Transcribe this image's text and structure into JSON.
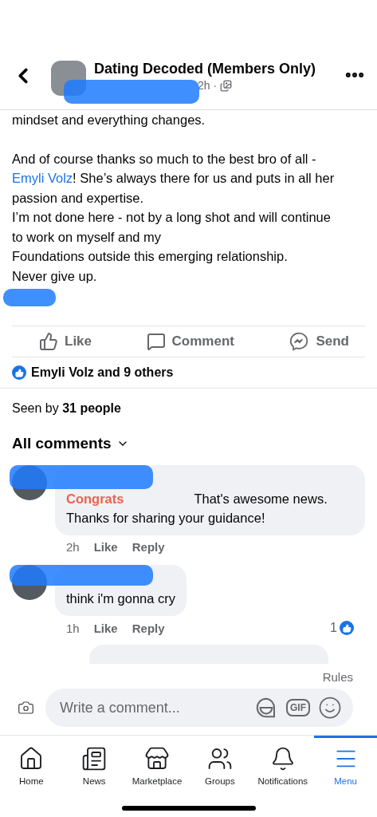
{
  "header": {
    "title": "Dating Decoded (Members Only)",
    "time": "2h ·"
  },
  "post": {
    "cut_line": "mindset and everything changes.",
    "paragraphs": [
      {
        "before": "And of course thanks so much to the best bro of all - ",
        "link": "Emyli Volz",
        "after": "! She’s always there for us and puts in all her passion and expertise."
      },
      {
        "before": "I’m not done here - not by a long shot and will continue to work on myself and my"
      },
      {
        "before": "Foundations outside this emerging relationship."
      },
      {
        "before": "Never give up."
      }
    ]
  },
  "actions": [
    {
      "kind": "like",
      "label": "Like"
    },
    {
      "kind": "comment",
      "label": "Comment"
    },
    {
      "kind": "send",
      "label": "Send"
    }
  ],
  "reactions": "Emyli Volz and 9 others",
  "seen": {
    "prefix": "Seen by ",
    "count": "31 people"
  },
  "comments_filter": "All comments",
  "comments": [
    {
      "mention": "Congrats",
      "text": "That's awesome news. Thanks for sharing your guidance!",
      "time": "2h",
      "like": "Like",
      "reply": "Reply"
    },
    {
      "text": "think i'm gonna cry",
      "time": "1h",
      "like": "Like",
      "reply": "Reply",
      "reaction_count": "1"
    }
  ],
  "rules": "Rules",
  "composer": {
    "placeholder": "Write a comment...",
    "gif": "GIF"
  },
  "nav": [
    {
      "kind": "home",
      "label": "Home",
      "selected": false
    },
    {
      "kind": "news",
      "label": "News",
      "selected": false
    },
    {
      "kind": "marketplace",
      "label": "Marketplace",
      "selected": false
    },
    {
      "kind": "groups",
      "label": "Groups",
      "selected": false
    },
    {
      "kind": "notifications",
      "label": "Notifications",
      "selected": false
    },
    {
      "kind": "menu",
      "label": "Menu",
      "selected": true
    }
  ]
}
